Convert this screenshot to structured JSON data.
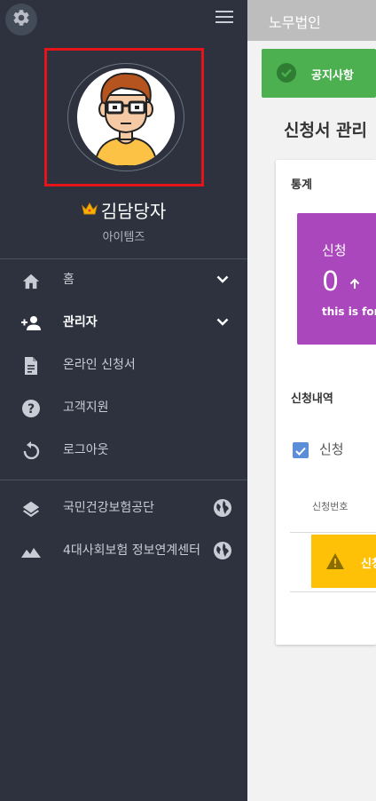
{
  "sidebar": {
    "user": {
      "name": "김담당자",
      "org": "아이템즈",
      "badge_icon": "crown-icon"
    },
    "nav": [
      {
        "label": "홈",
        "icon": "home-icon",
        "has_chevron": true
      },
      {
        "label": "관리자",
        "icon": "add-user-icon",
        "has_chevron": true,
        "active": true
      },
      {
        "label": "온라인 신청서",
        "icon": "document-icon"
      },
      {
        "label": "고객지원",
        "icon": "help-icon"
      },
      {
        "label": "로그아웃",
        "icon": "refresh-icon"
      }
    ],
    "links": [
      {
        "label": "국민건강보험공단",
        "icon": "layers-icon"
      },
      {
        "label": "4대사회보험 정보연계센터",
        "icon": "landscape-icon"
      }
    ]
  },
  "header": {
    "title": "노무법인"
  },
  "notice": {
    "label": "공지사항"
  },
  "main": {
    "title": "신청서 관리",
    "stats_label": "통계",
    "stat": {
      "title": "신청",
      "value": "0",
      "desc": "this is for"
    },
    "history_label": "신청내역",
    "filter": {
      "label": "신청",
      "checked": true
    },
    "table": {
      "column": "신청번호"
    },
    "warning": {
      "text": "신청"
    }
  },
  "colors": {
    "sidebar": "#2d323e",
    "notice": "#4caf50",
    "stat_card": "#ab47bc",
    "warning": "#ffc107",
    "checkbox": "#5b8dd9",
    "highlight": "#e3151b"
  }
}
